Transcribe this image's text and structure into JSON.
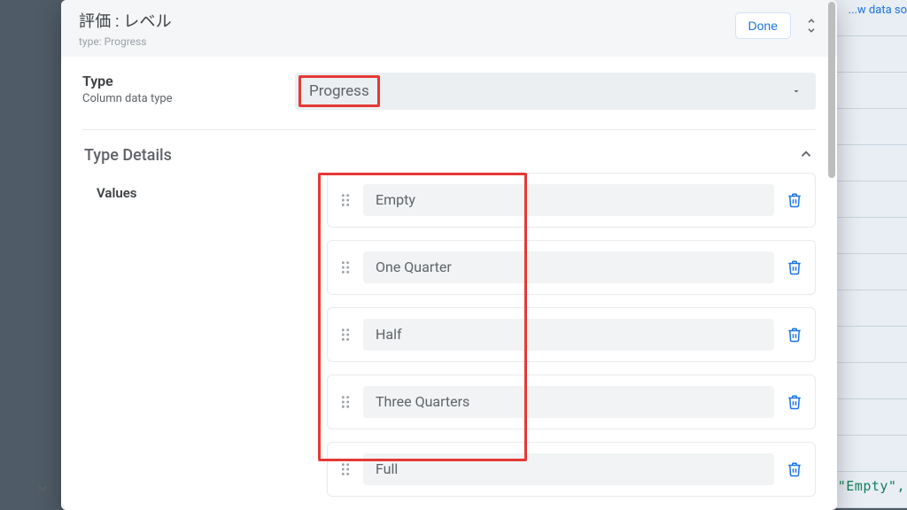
{
  "background": {
    "top_link_fragment": "...w data so",
    "bottom_code_fragment": "\"Empty\",",
    "left_chevron": "⌄"
  },
  "dialog": {
    "title": "評価 : レベル",
    "subtitle_label": "type:",
    "subtitle_value": "Progress",
    "done_label": "Done",
    "type_section": {
      "label": "Type",
      "sublabel": "Column data type",
      "selected": "Progress"
    },
    "details": {
      "title": "Type Details",
      "values_label": "Values",
      "values": [
        "Empty",
        "One Quarter",
        "Half",
        "Three Quarters",
        "Full"
      ]
    }
  }
}
